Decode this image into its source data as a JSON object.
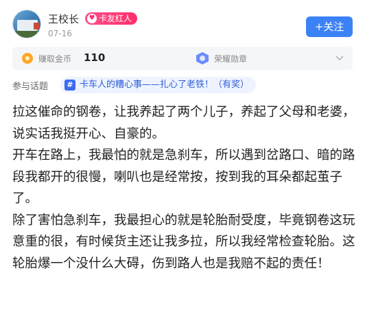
{
  "author": {
    "name": "王校长",
    "badge": "卡友红人",
    "date": "07-16"
  },
  "follow_label": "+关注",
  "stats": {
    "coin_label": "赚取金币",
    "coin_value": "110",
    "medal_label": "荣耀勋章"
  },
  "topic": {
    "label": "参与话题",
    "title": "卡车人的糟心事——扎心了老铁！（有奖）"
  },
  "post": {
    "paragraphs": [
      "拉这催命的钢卷，让我养起了两个儿子，养起了父母和老婆，说实话我挺开心、自豪的。",
      "开车在路上，我最怕的就是急刹车，所以遇到岔路口、暗的路段我都开的很慢，喇叭也是经常按，按到我的耳朵都起茧子了。",
      "除了害怕急刹车，我最担心的就是轮胎耐受度，毕竟钢卷这玩意重的很，有时候货主还让我多拉，所以我经常检查轮胎。这轮胎爆一个没什么大碍，伤到路人也是我赔不起的责任！"
    ]
  },
  "icons": {
    "coin": "coin-icon",
    "medal": "medal-icon",
    "chevron": "chevron-down-icon",
    "topic": "hash-icon",
    "badge": "heart-icon"
  },
  "colors": {
    "accent": "#3b82f6",
    "badge": "#ff2e6c",
    "topic_text": "#2f5fd6",
    "coin": "#ffa726"
  }
}
